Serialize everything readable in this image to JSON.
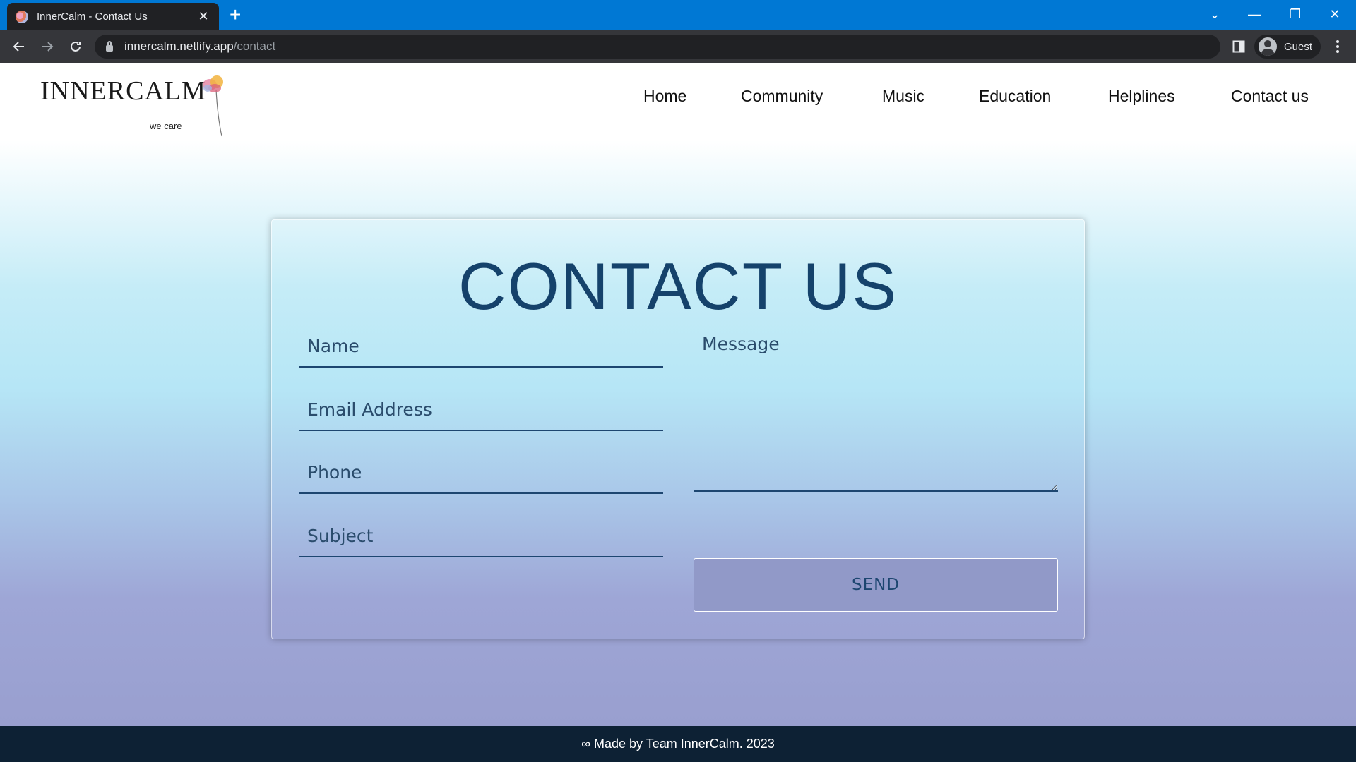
{
  "browser": {
    "tab_title": "InnerCalm - Contact Us",
    "tab_close": "✕",
    "new_tab": "+",
    "url_host": "innercalm.netlify.app",
    "url_path": "/contact",
    "profile_label": "Guest",
    "icons": {
      "back": "arrow-left-icon",
      "forward": "arrow-right-icon",
      "reload": "reload-icon",
      "lock": "lock-icon",
      "side_panel": "side-panel-icon",
      "menu": "kebab-menu-icon"
    },
    "window_controls": {
      "tab_search": "⌄",
      "minimize": "—",
      "restore": "❐",
      "close": "✕"
    },
    "colors": {
      "tabbar": "#0078d4",
      "toolbar": "#35363a"
    }
  },
  "site": {
    "logo_text": "INNERCALM",
    "logo_tagline": "we care",
    "nav": [
      "Home",
      "Community",
      "Music",
      "Education",
      "Helplines",
      "Contact us"
    ]
  },
  "contact": {
    "title": "CONTACT US",
    "fields": {
      "name_placeholder": "Name",
      "email_placeholder": "Email Address",
      "phone_placeholder": "Phone",
      "subject_placeholder": "Subject",
      "message_placeholder": "Message"
    },
    "send_label": "SEND"
  },
  "footer": {
    "text": "∞ Made by Team InnerCalm. 2023"
  },
  "colors": {
    "title": "#15426b",
    "button": "#9199c8",
    "footer": "#0d2134"
  }
}
